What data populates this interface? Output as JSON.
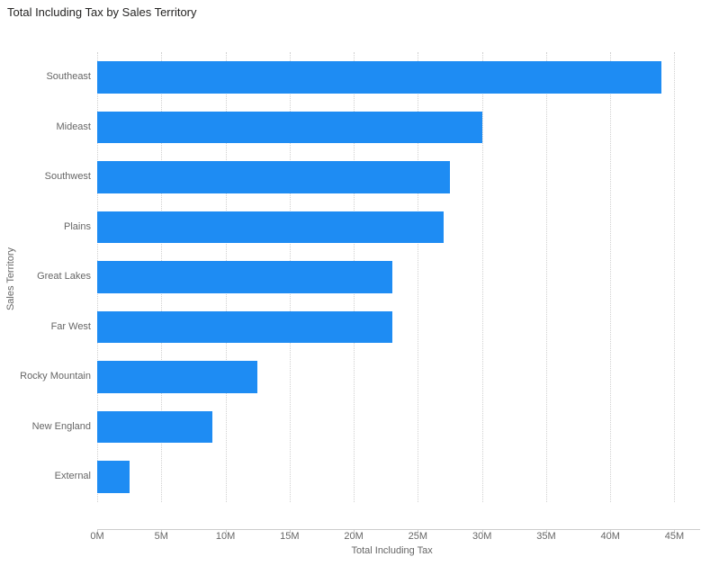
{
  "chart_data": {
    "type": "bar",
    "orientation": "horizontal",
    "title": "Total Including Tax by Sales Territory",
    "xlabel": "Total Including Tax",
    "ylabel": "Sales Territory",
    "categories": [
      "Southeast",
      "Mideast",
      "Southwest",
      "Plains",
      "Great Lakes",
      "Far West",
      "Rocky Mountain",
      "New England",
      "External"
    ],
    "values": [
      44000000,
      30000000,
      27500000,
      27000000,
      23000000,
      23000000,
      12500000,
      9000000,
      2500000
    ],
    "xlim": [
      0,
      47000000
    ],
    "x_ticks": [
      0,
      5000000,
      10000000,
      15000000,
      20000000,
      25000000,
      30000000,
      35000000,
      40000000,
      45000000
    ],
    "x_tick_labels": [
      "0M",
      "5M",
      "10M",
      "15M",
      "20M",
      "25M",
      "30M",
      "35M",
      "40M",
      "45M"
    ],
    "bar_color": "#1e8cf3"
  }
}
